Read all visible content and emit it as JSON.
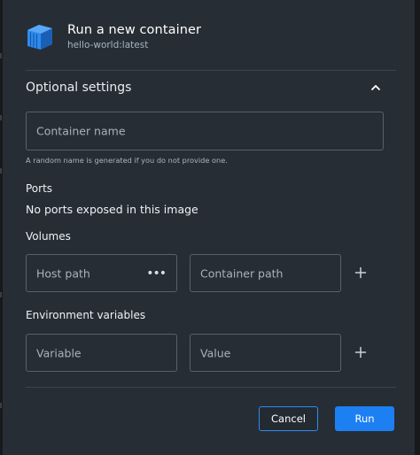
{
  "header": {
    "title": "Run a new container",
    "subtitle": "hello-world:latest",
    "icon": "docker-container-icon"
  },
  "optional_settings": {
    "title": "Optional settings",
    "expanded": true
  },
  "container_name": {
    "placeholder": "Container name",
    "value": "",
    "help": "A random name is generated if you do not provide one."
  },
  "ports": {
    "label": "Ports",
    "text": "No ports exposed in this image"
  },
  "volumes": {
    "label": "Volumes",
    "host_path_placeholder": "Host path",
    "container_path_placeholder": "Container path",
    "browse_label": "•••"
  },
  "env": {
    "label": "Environment variables",
    "variable_placeholder": "Variable",
    "value_placeholder": "Value"
  },
  "actions": {
    "cancel_label": "Cancel",
    "run_label": "Run"
  },
  "colors": {
    "dialog_bg": "#262d35",
    "accent": "#1d80f2",
    "border": "#56616d"
  }
}
